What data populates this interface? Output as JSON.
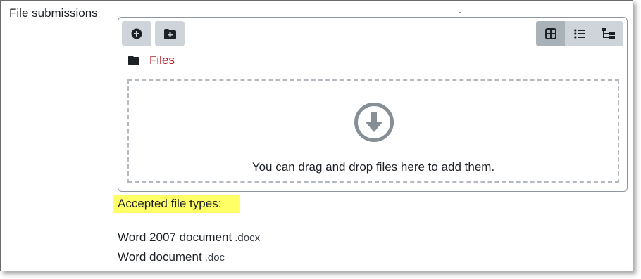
{
  "field": {
    "label": "File submissions"
  },
  "filepicker": {
    "toolbar": {
      "add_icon": "plus-circle-icon",
      "mkdir_icon": "folder-plus-icon"
    },
    "views": [
      {
        "icon": "grid-icon",
        "active": true
      },
      {
        "icon": "list-icon",
        "active": false
      },
      {
        "icon": "tree-icon",
        "active": false
      }
    ],
    "path": {
      "folder_icon": "folder-icon",
      "label": "Files"
    },
    "dropzone": {
      "icon": "arrow-down-circle-icon",
      "text": "You can drag and drop files here to add them."
    }
  },
  "accepted": {
    "heading": "Accepted file types:",
    "types": [
      {
        "name": "Word 2007 document",
        "ext": ".docx"
      },
      {
        "name": "Word document",
        "ext": ".doc"
      }
    ]
  },
  "colors": {
    "link": "#b81623",
    "highlight": "#ffff66",
    "button_bg": "#ced4da",
    "active_view_bg": "#a9b1b9"
  }
}
